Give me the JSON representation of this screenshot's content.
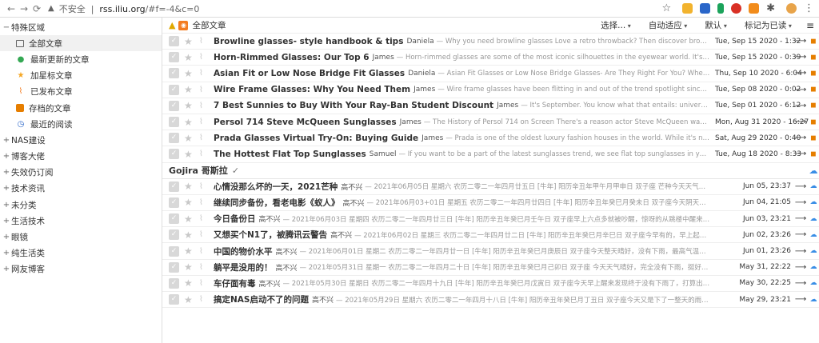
{
  "browser": {
    "security_label": "不安全",
    "url_host": "rss.iliu.org",
    "url_path": "/#f=-4&c=0"
  },
  "sidebar": {
    "special_group": "特殊区域",
    "special_items": [
      {
        "label": "全部文章",
        "icon": "folder-icon"
      },
      {
        "label": "最新更新的文章",
        "icon": "fresh-icon"
      },
      {
        "label": "加星标文章",
        "icon": "star-icon"
      },
      {
        "label": "已发布文章",
        "icon": "rss-icon"
      },
      {
        "label": "存档的文章",
        "icon": "archive-icon"
      },
      {
        "label": "最近的阅读",
        "icon": "history-icon"
      }
    ],
    "categories": [
      "NAS建设",
      "博客大佬",
      "失效仍订阅",
      "技术资讯",
      "未分类",
      "生活技术",
      "眼镜",
      "纯生活类",
      "网友博客"
    ]
  },
  "toolbar": {
    "feed_title": "全部文章",
    "select_label": "选择...",
    "auto_label": "自动适应",
    "default_label": "默认",
    "mark_read_label": "标记为已读"
  },
  "articles_a": [
    {
      "title": "Browline glasses- style handbook & tips",
      "author": "Daniela",
      "excerpt": "— Why you need browline glasses Love a retro throwback? Then discover browline glasses and sunglasses. ...",
      "date": "Tue, Sep 15 2020 - 1:32"
    },
    {
      "title": "Horn-Rimmed Glasses: Our Top 6",
      "author": "James",
      "excerpt": "— Horn-rimmed glasses are some of the most iconic silhouettes in the eyewear world. It's been a while since their inven...",
      "date": "Tue, Sep 15 2020 - 0:39"
    },
    {
      "title": "Asian Fit or Low Nose Bridge Fit Glasses",
      "author": "Daniela",
      "excerpt": "— Asian Fit Glasses or Low Nose Bridge Glasses- Are They Right For You? Whether you're an Asian or not, if ...",
      "date": "Thu, Sep 10 2020 - 6:04"
    },
    {
      "title": "Wire Frame Glasses: Why You Need Them",
      "author": "James",
      "excerpt": "— Wire frame glasses have been flitting in and out of the trend spotlight since glasses were really invented. ...",
      "date": "Tue, Sep 08 2020 - 0:02"
    },
    {
      "title": "7 Best Sunnies to Buy With Your Ray-Ban Student Discount",
      "author": "James",
      "excerpt": "— It's September. You know what that entails: universities, colleges and schools will b...",
      "date": "Tue, Sep 01 2020 - 6:12"
    },
    {
      "title": "Persol 714 Steve McQueen Sunglasses",
      "author": "James",
      "excerpt": "— The History of Persol 714 on Screen There's a reason actor Steve McQueen was known as the \"king of cool\" ...",
      "date": "Mon, Aug 31 2020 - 16:27"
    },
    {
      "title": "Prada Glasses Virtual Try-On: Buying Guide",
      "author": "James",
      "excerpt": "— Prada is one of the oldest luxury fashion houses in the world. While it's now one of the most recognisabl...",
      "date": "Sat, Aug 29 2020 - 0:40"
    },
    {
      "title": "The Hottest Flat Top Sunglasses",
      "author": "Samuel",
      "excerpt": "— If you want to be a part of the latest sunglasses trend, we see flat top sunglasses in your future. A bold choice for any...",
      "date": "Tue, Aug 18 2020 - 8:33"
    }
  ],
  "feed_b_title": "Gojira 哥斯拉",
  "articles_b": [
    {
      "title": "心情没那么坏的一天，2021芒种",
      "author": "高不兴",
      "excerpt": "— 2021年06月05日 星期六 农历二零二一年四月廿五日 [牛年] 阳历辛丑年甲午月甲申日 双子座 芒种今天天气晴，早上很早就起来了，去...",
      "date": "Jun 05, 23:37"
    },
    {
      "title": "继续同步备份，看老电影《蚁人》",
      "author": "高不兴",
      "excerpt": "— 2021年06月03+01日 星期五 农历二零二一年四月廿四日 [牛年] 阳历辛丑年癸巳月癸未日 双子座今天阴天，气温也不错，最主要的是...",
      "date": "Jun 04, 21:05"
    },
    {
      "title": "今日备份日",
      "author": "高不兴",
      "excerpt": "— 2021年06月03日 星期四 农历二零二一年四月廿三日 [牛年] 阳历辛丑年癸巳月壬午日 双子座早上六点多就被吵醒，惊呀的从跳楼中醒来，非常的惊衣，这样的...",
      "date": "Jun 03, 23:21"
    },
    {
      "title": "又想买个N1了，被腾讯云警告",
      "author": "高不兴",
      "excerpt": "— 2021年06月02日 星期三 农历二零二一年四月廿二日 [牛年] 阳历辛丑年癸巳月辛巳日 双子座今早有的，早上起了个大早，外面却下着雨，...",
      "date": "Jun 02, 23:26"
    },
    {
      "title": "中国的物价水平",
      "author": "高不兴",
      "excerpt": "— 2021年06月01日 星期二 农历二零二一年四月廿一日 [牛年] 阳历辛丑年癸巳月庚辰日 双子座今天整天晴好，没有下雨，最高气温33度，上午在1楼书房我...",
      "date": "Jun 01, 23:26"
    },
    {
      "title": "躺平是没用的！",
      "author": "高不兴",
      "excerpt": "— 2021年05月31日 星期一 农历二零二一年四月二十日 [牛年] 阳历辛丑年癸巳月己卯日 双子座 今天天气晴好，完全没有下雨，挺好的。虽然天气挺好的，但...",
      "date": "May 31, 22:22"
    },
    {
      "title": "车仔面有毒",
      "author": "高不兴",
      "excerpt": "— 2021年05月30日 星期日 农历二零二一年四月十九日 [牛年] 阳历辛丑年癸巳月戊寅日 双子座今天早上醒来发现终于没有下雨了，打算出去玩，但是稍微收拾，...",
      "date": "May 30, 22:25"
    },
    {
      "title": "搞定NAS启动不了的问题",
      "author": "高不兴",
      "excerpt": "— 2021年05月29日 星期六 农历二零二一年四月十八日 [牛年] 阳历辛丑年癸巳月丁丑日 双子座今天又是下了一整天的雨，没伸过，去哪里都不方...",
      "date": "May 29, 23:21"
    }
  ]
}
